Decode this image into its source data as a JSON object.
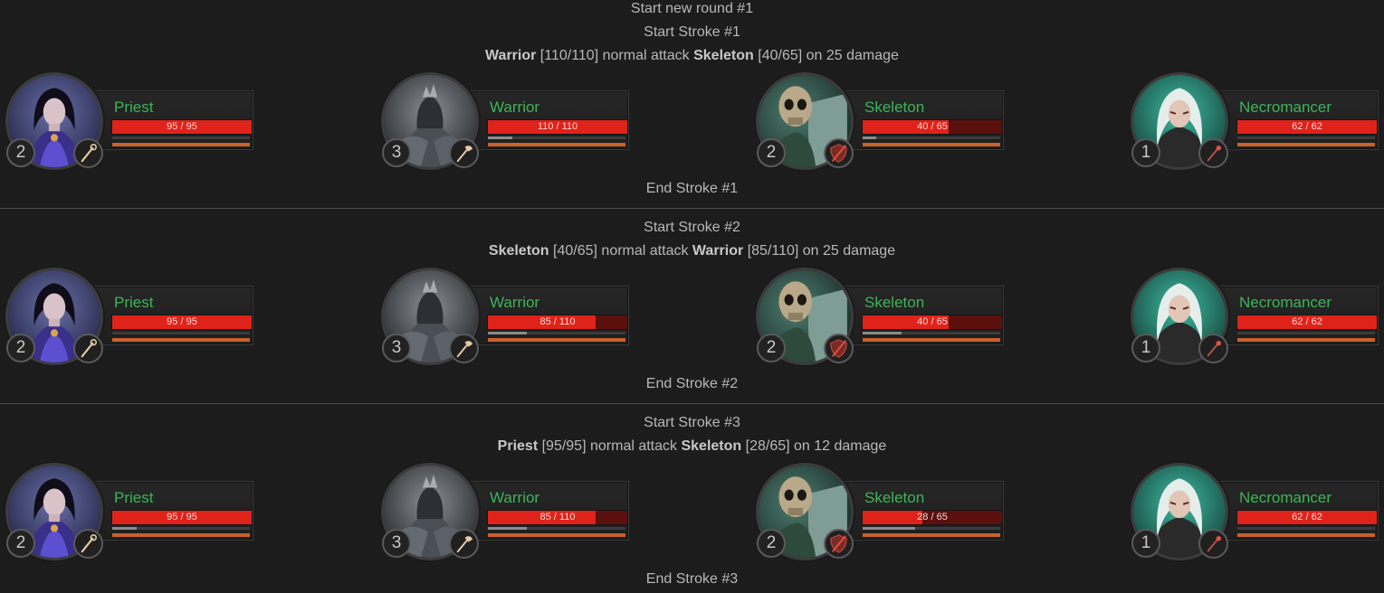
{
  "round_title": "Start new round #1",
  "strokes": [
    {
      "start": "Start Stroke #1",
      "log": {
        "attacker": "Warrior",
        "attacker_hp": "[110/110]",
        "action": "normal attack",
        "target": "Skeleton",
        "target_hp": "[40/65]",
        "suffix": "on 25 damage"
      },
      "end": "End Stroke #1",
      "units": [
        {
          "name": "Priest",
          "hp": "95 / 95",
          "hp_frac": 1.0,
          "xp_frac": 0.0,
          "level": "2",
          "portrait": "priest-portrait",
          "weapon": "staff-icon"
        },
        {
          "name": "Warrior",
          "hp": "110 / 110",
          "hp_frac": 1.0,
          "xp_frac": 0.18,
          "level": "3",
          "portrait": "warrior-portrait",
          "weapon": "axe-icon"
        },
        {
          "name": "Skeleton",
          "hp": "40 / 65",
          "hp_frac": 0.615,
          "xp_frac": 0.1,
          "level": "2",
          "portrait": "skeleton-portrait",
          "weapon": "broken-shield-icon"
        },
        {
          "name": "Necromancer",
          "hp": "62 / 62",
          "hp_frac": 1.0,
          "xp_frac": 0.0,
          "level": "1",
          "portrait": "necromancer-portrait",
          "weapon": "wand-icon"
        }
      ]
    },
    {
      "start": "Start Stroke #2",
      "log": {
        "attacker": "Skeleton",
        "attacker_hp": "[40/65]",
        "action": "normal attack",
        "target": "Warrior",
        "target_hp": "[85/110]",
        "suffix": "on 25 damage"
      },
      "end": "End Stroke #2",
      "units": [
        {
          "name": "Priest",
          "hp": "95 / 95",
          "hp_frac": 1.0,
          "xp_frac": 0.0,
          "level": "2",
          "portrait": "priest-portrait",
          "weapon": "staff-icon"
        },
        {
          "name": "Warrior",
          "hp": "85 / 110",
          "hp_frac": 0.773,
          "xp_frac": 0.28,
          "level": "3",
          "portrait": "warrior-portrait",
          "weapon": "axe-icon"
        },
        {
          "name": "Skeleton",
          "hp": "40 / 65",
          "hp_frac": 0.615,
          "xp_frac": 0.28,
          "level": "2",
          "portrait": "skeleton-portrait",
          "weapon": "broken-shield-icon"
        },
        {
          "name": "Necromancer",
          "hp": "62 / 62",
          "hp_frac": 1.0,
          "xp_frac": 0.0,
          "level": "1",
          "portrait": "necromancer-portrait",
          "weapon": "wand-icon"
        }
      ]
    },
    {
      "start": "Start Stroke #3",
      "log": {
        "attacker": "Priest",
        "attacker_hp": "[95/95]",
        "action": "normal attack",
        "target": "Skeleton",
        "target_hp": "[28/65]",
        "suffix": "on 12 damage"
      },
      "end": "End Stroke #3",
      "units": [
        {
          "name": "Priest",
          "hp": "95 / 95",
          "hp_frac": 1.0,
          "xp_frac": 0.18,
          "level": "2",
          "portrait": "priest-portrait",
          "weapon": "staff-icon"
        },
        {
          "name": "Warrior",
          "hp": "85 / 110",
          "hp_frac": 0.773,
          "xp_frac": 0.28,
          "level": "3",
          "portrait": "warrior-portrait",
          "weapon": "axe-icon"
        },
        {
          "name": "Skeleton",
          "hp": "28 / 65",
          "hp_frac": 0.43,
          "xp_frac": 0.38,
          "level": "2",
          "portrait": "skeleton-portrait",
          "weapon": "broken-shield-icon"
        },
        {
          "name": "Necromancer",
          "hp": "62 / 62",
          "hp_frac": 1.0,
          "xp_frac": 0.0,
          "level": "1",
          "portrait": "necromancer-portrait",
          "weapon": "wand-icon"
        }
      ]
    }
  ],
  "colors": {
    "hp": "#e0231a",
    "hp_missing": "#5b100d",
    "name": "#3fb35a",
    "resource": "#c8612c"
  }
}
